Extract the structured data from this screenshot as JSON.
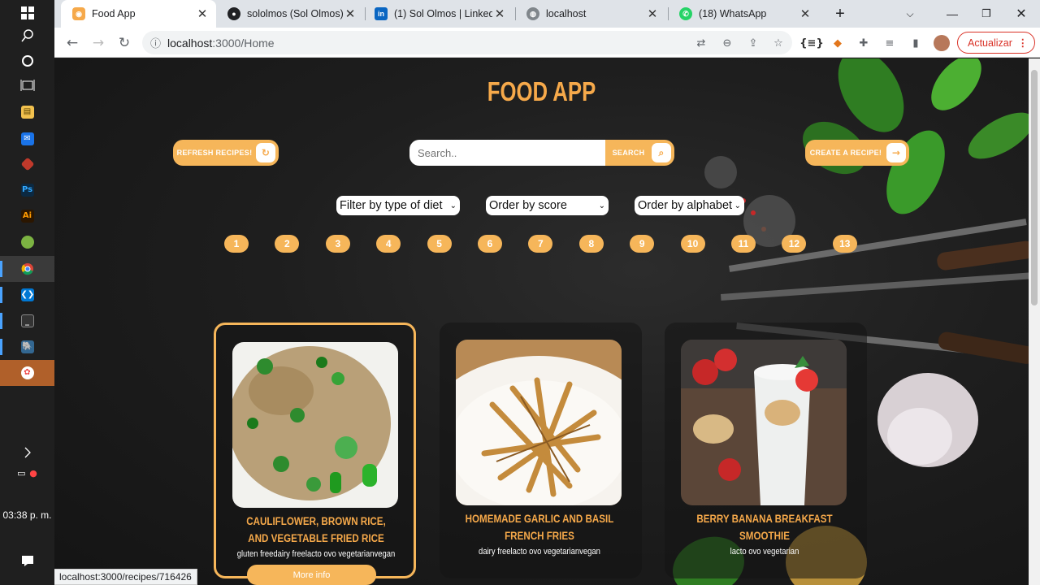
{
  "taskbar": {
    "clock": "03:38 p. m."
  },
  "browser": {
    "tabs": [
      {
        "title": "Food App",
        "active": true
      },
      {
        "title": "sololmos (Sol Olmos)"
      },
      {
        "title": "(1) Sol Olmos | LinkedIn"
      },
      {
        "title": "localhost"
      },
      {
        "title": "(18) WhatsApp"
      }
    ],
    "url_host": "localhost",
    "url_path": ":3000/Home",
    "update_label": "Actualizar",
    "status_url": "localhost:3000/recipes/716426"
  },
  "app": {
    "title": "FOOD APP",
    "refresh_label": "REFRESH RECIPES!",
    "search_placeholder": "Search..",
    "search_label": "SEARCH",
    "create_label": "CREATE A RECIPE!",
    "filters": {
      "diet": "Filter by type of diet",
      "score": "Order by score",
      "alphabet": "Order by alphabet"
    },
    "pages": [
      "1",
      "2",
      "3",
      "4",
      "5",
      "6",
      "7",
      "8",
      "9",
      "10",
      "11",
      "12",
      "13"
    ],
    "cards": [
      {
        "name": "CAULIFLOWER, BROWN RICE, AND VEGETABLE FRIED RICE",
        "diets": "gluten freedairy freelacto ovo vegetarianvegan"
      },
      {
        "name": "HOMEMADE GARLIC AND BASIL FRENCH FRIES",
        "diets": "dairy freelacto ovo vegetarianvegan"
      },
      {
        "name": "BERRY BANANA BREAKFAST SMOOTHIE",
        "diets": "lacto ovo vegetarian"
      }
    ],
    "more_info": "More info"
  }
}
